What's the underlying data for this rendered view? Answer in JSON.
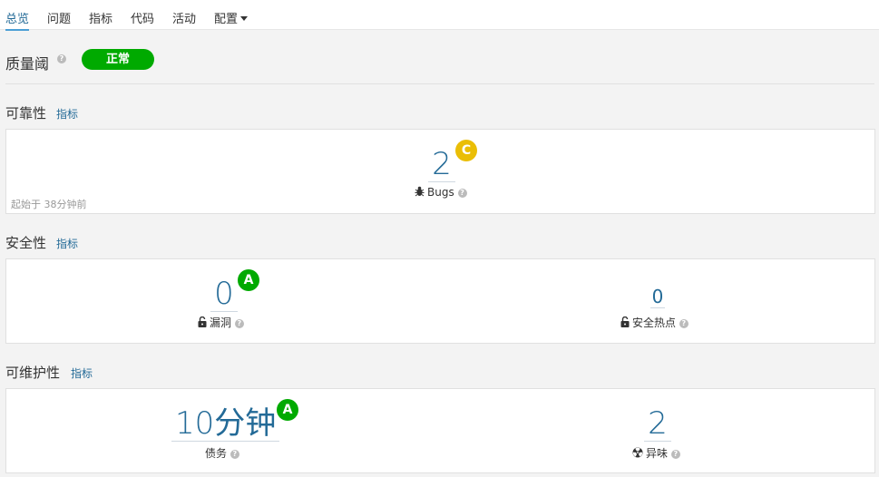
{
  "nav": {
    "items": [
      {
        "label": "总览",
        "active": true
      },
      {
        "label": "问题"
      },
      {
        "label": "指标"
      },
      {
        "label": "代码"
      },
      {
        "label": "活动"
      },
      {
        "label": "配置"
      }
    ]
  },
  "quality_gate": {
    "title": "质量阈",
    "status": "正常",
    "status_color": "#00aa00"
  },
  "reliability": {
    "title": "可靠性",
    "link": "指标",
    "bugs_value": "2",
    "bugs_rating": "C",
    "bugs_rating_color": "#eabe06",
    "bugs_label": "Bugs",
    "since": "起始于 38分钟前"
  },
  "security": {
    "title": "安全性",
    "link": "指标",
    "vulns_value": "0",
    "vulns_rating": "A",
    "vulns_rating_color": "#00aa00",
    "vulns_label": "漏洞",
    "hotspots_value": "0",
    "hotspots_label": "安全热点"
  },
  "maintainability": {
    "title": "可维护性",
    "link": "指标",
    "debt_value": "10分钟",
    "debt_rating": "A",
    "debt_rating_color": "#00aa00",
    "debt_label": "债务",
    "smells_value": "2",
    "smells_label": "异味"
  }
}
